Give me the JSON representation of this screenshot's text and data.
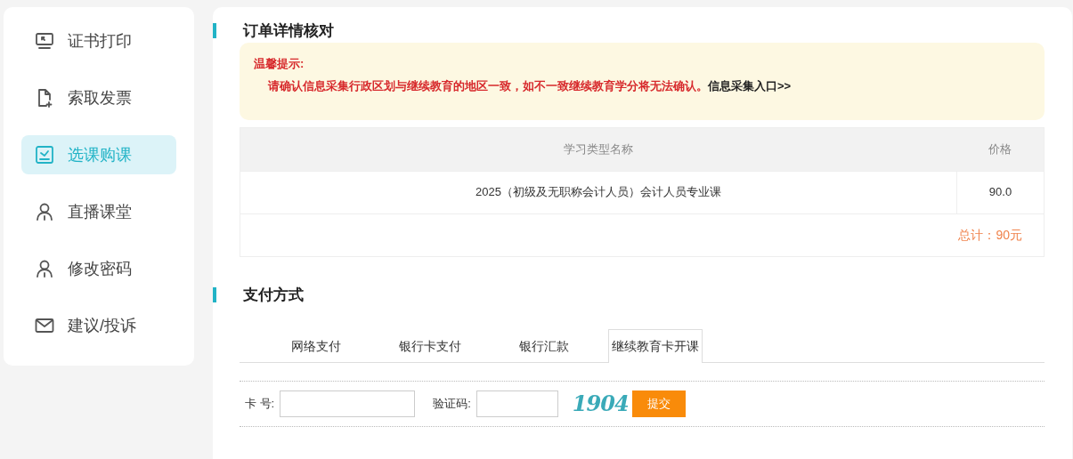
{
  "sidebar": {
    "items": [
      {
        "label": "证书打印",
        "selected": false
      },
      {
        "label": "索取发票",
        "selected": false
      },
      {
        "label": "选课购课",
        "selected": true
      },
      {
        "label": "直播课堂",
        "selected": false
      },
      {
        "label": "修改密码",
        "selected": false
      },
      {
        "label": "建议/投诉",
        "selected": false
      }
    ]
  },
  "order": {
    "title": "订单详情核对",
    "notice": {
      "title": "温馨提示:",
      "message": "请确认信息采集行政区划与继续教育的地区一致，如不一致继续教育学分将无法确认。",
      "link": "信息采集入口>>"
    },
    "table": {
      "columns": [
        "学习类型名称",
        "价格"
      ],
      "rows": [
        [
          "2025（初级及无职称会计人员）会计人员专业课",
          "90.0"
        ]
      ],
      "total": "总计：90元"
    }
  },
  "payment": {
    "title": "支付方式",
    "tabs": [
      {
        "label": "网络支付",
        "selected": false
      },
      {
        "label": "银行卡支付",
        "selected": false
      },
      {
        "label": "银行汇款",
        "selected": false
      },
      {
        "label": "继续教育卡开课",
        "selected": true
      }
    ],
    "form": {
      "card_label": "卡 号:",
      "code_label": "验证码:",
      "captcha": "1904",
      "submit": "提交"
    }
  }
}
